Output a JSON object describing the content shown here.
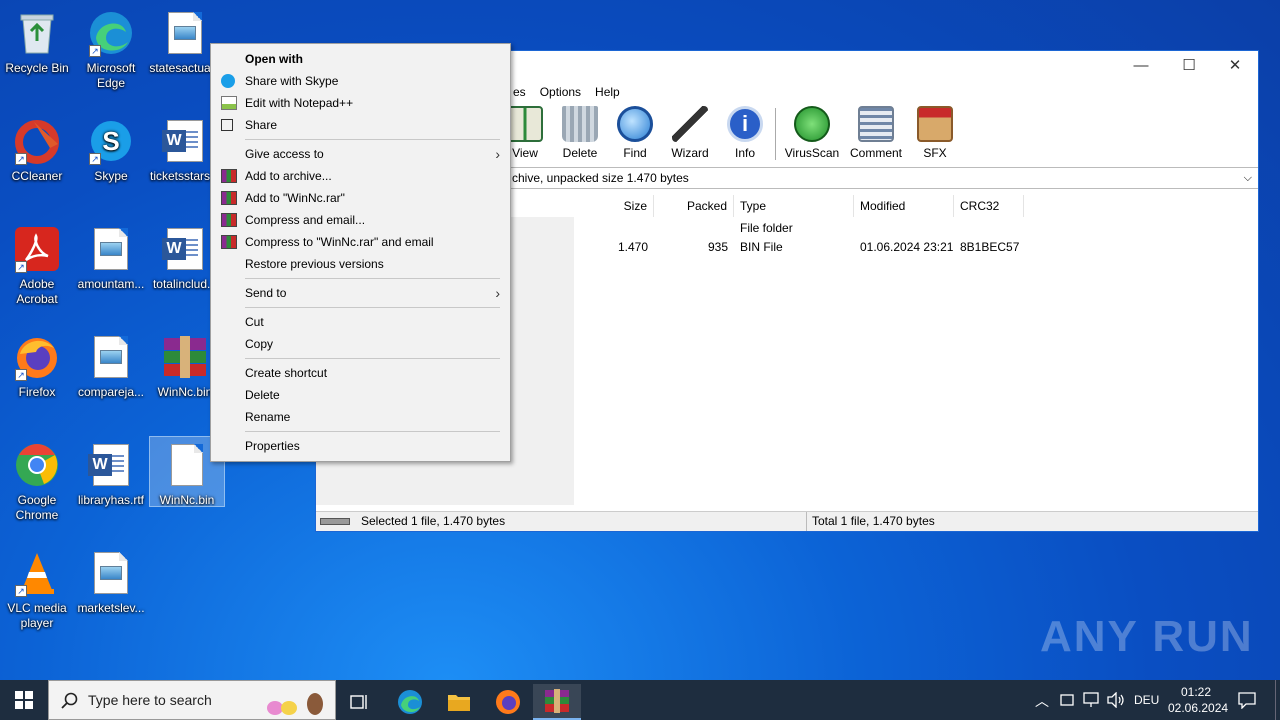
{
  "desktop": {
    "icons": [
      {
        "label": "Recycle Bin"
      },
      {
        "label": "Microsoft Edge"
      },
      {
        "label": "statesactua..."
      },
      {
        "label": "CCleaner"
      },
      {
        "label": "Skype"
      },
      {
        "label": "ticketsstars..."
      },
      {
        "label": "Adobe Acrobat"
      },
      {
        "label": "amountam..."
      },
      {
        "label": "totalinclud..."
      },
      {
        "label": "Firefox"
      },
      {
        "label": "compareja..."
      },
      {
        "label": "WinNc.bin"
      },
      {
        "label": "Google Chrome"
      },
      {
        "label": "libraryhas.rtf"
      },
      {
        "label": "WinNc.bin"
      },
      {
        "label": "VLC media player"
      },
      {
        "label": "marketslev..."
      }
    ]
  },
  "winrar": {
    "menu": [
      "es",
      "Options",
      "Help"
    ],
    "toolbar": [
      "View",
      "Delete",
      "Find",
      "Wizard",
      "Info",
      "VirusScan",
      "Comment",
      "SFX"
    ],
    "path_text": "chive, unpacked size 1.470 bytes",
    "columns": [
      "Size",
      "Packed",
      "Type",
      "Modified",
      "CRC32"
    ],
    "rows": [
      {
        "size": "",
        "packed": "",
        "type": "File folder",
        "modified": "",
        "crc": ""
      },
      {
        "size": "1.470",
        "packed": "935",
        "type": "BIN File",
        "modified": "01.06.2024 23:21",
        "crc": "8B1BEC57"
      }
    ],
    "status_left": "Selected 1 file, 1.470 bytes",
    "status_right": "Total 1 file, 1.470 bytes"
  },
  "context_menu": {
    "items": [
      {
        "label": "Open with"
      },
      {
        "label": "Share with Skype"
      },
      {
        "label": "Edit with Notepad++"
      },
      {
        "label": "Share"
      },
      {
        "label": "Give access to"
      },
      {
        "label": "Add to archive..."
      },
      {
        "label": "Add to \"WinNc.rar\""
      },
      {
        "label": "Compress and email..."
      },
      {
        "label": "Compress to \"WinNc.rar\" and email"
      },
      {
        "label": "Restore previous versions"
      },
      {
        "label": "Send to"
      },
      {
        "label": "Cut"
      },
      {
        "label": "Copy"
      },
      {
        "label": "Create shortcut"
      },
      {
        "label": "Delete"
      },
      {
        "label": "Rename"
      },
      {
        "label": "Properties"
      }
    ]
  },
  "taskbar": {
    "search_placeholder": "Type here to search",
    "language": "DEU",
    "time": "01:22",
    "date": "02.06.2024"
  },
  "watermark": "ANY RUN"
}
